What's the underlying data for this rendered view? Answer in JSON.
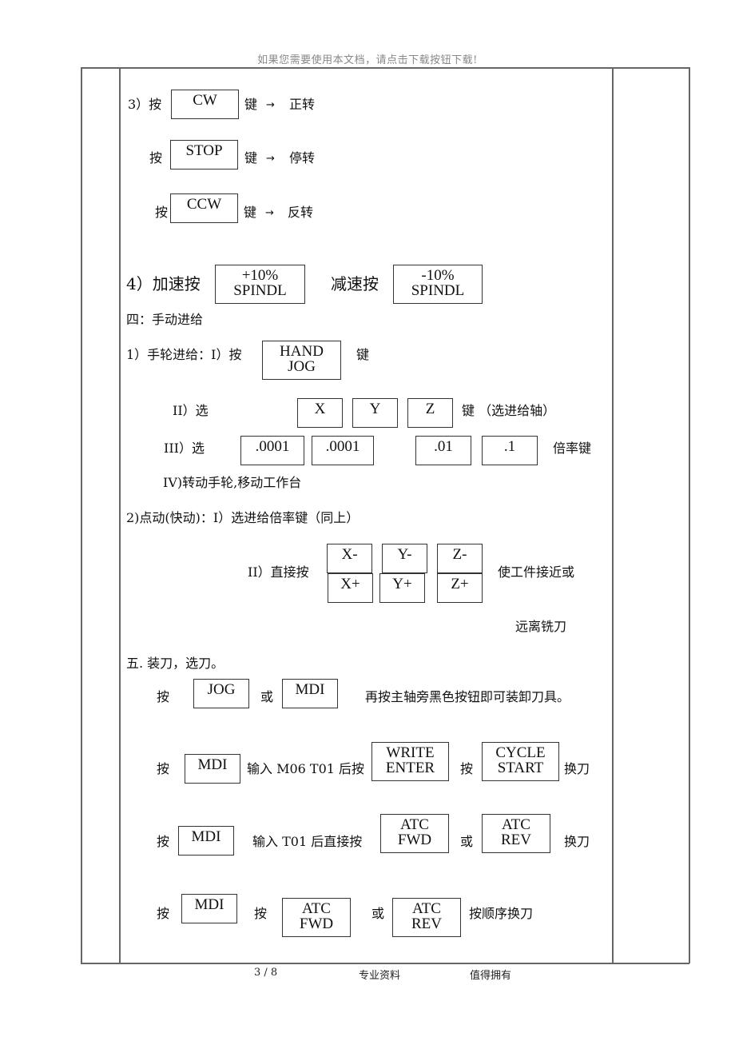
{
  "header": {
    "notice": "如果您需要使用本文档，请点击下载按钮下载!"
  },
  "footer": {
    "page": "3 / 8",
    "tag1": "专业资料",
    "tag2": "值得拥有"
  },
  "spindle": {
    "cw": {
      "prefix": "3）按",
      "key": "CW",
      "suffix": "键",
      "arrow": "→",
      "result": "正转"
    },
    "stop": {
      "prefix": "按",
      "key": "STOP",
      "suffix": "键",
      "arrow": "→",
      "result": "停转"
    },
    "ccw": {
      "prefix": "按",
      "key": "CCW",
      "suffix": "键",
      "arrow": "→",
      "result": "反转"
    },
    "speed": {
      "accel_label": "4）加速按",
      "accel_key": [
        "+10%",
        "SPINDL"
      ],
      "decel_label": "减速按",
      "decel_key": [
        "-10%",
        "SPINDL"
      ]
    }
  },
  "manual_feed": {
    "title": "四：手动进给",
    "handwheel": {
      "step1_label": "1）手轮进给：I）按",
      "step1_key": [
        "HAND",
        "JOG"
      ],
      "step1_suffix": "键",
      "step2_label": "II）选",
      "axis_keys": [
        "X",
        "Y",
        "Z"
      ],
      "step2_suffix": "键 （选进给轴）",
      "step3_label": "III）选",
      "rate_keys": [
        ".0001",
        ".0001",
        ".01",
        ".1"
      ],
      "step3_suffix": "倍率键",
      "step4": "IV)转动手轮,移动工作台"
    },
    "jog": {
      "step1": "2)点动(快动)：I）选进给倍率键（同上）",
      "step2_label": "II）直接按",
      "minus_keys": [
        "X-",
        "Y-",
        "Z-"
      ],
      "plus_keys": [
        "X+",
        "Y+",
        "Z+"
      ],
      "suffix1": "使工件接近或",
      "suffix2": "远离铣刀"
    }
  },
  "tool": {
    "title": "五. 装刀，选刀。",
    "row1": {
      "press": "按",
      "key1": "JOG",
      "or": "或",
      "key2": "MDI",
      "text": "再按主轴旁黑色按钮即可装卸刀具。"
    },
    "row2": {
      "press": "按",
      "key1": "MDI",
      "text1": "输入 M06  T01 后按",
      "key2": [
        "WRITE",
        "ENTER"
      ],
      "press2": "按",
      "key3": [
        "CYCLE",
        "START"
      ],
      "text2": "换刀"
    },
    "row3": {
      "press": "按",
      "key1": "MDI",
      "text1": "输入 T01 后直接按",
      "key2": [
        "ATC",
        "FWD"
      ],
      "or": "或",
      "key3": [
        "ATC",
        "REV"
      ],
      "text2": "换刀"
    },
    "row4": {
      "press": "按",
      "key1": "MDI",
      "press2": "按",
      "key2": [
        "ATC",
        "FWD"
      ],
      "or": "或",
      "key3": [
        "ATC",
        "REV"
      ],
      "text2": "按顺序换刀"
    }
  }
}
